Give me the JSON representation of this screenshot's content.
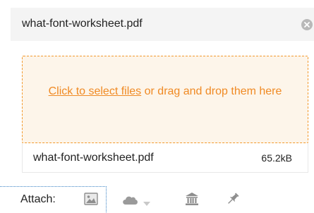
{
  "file_header": {
    "name": "what-font-worksheet.pdf",
    "remove_icon": "remove-circle-icon"
  },
  "dropzone": {
    "link_text": "Click to select files",
    "rest_text": " or drag and drop them here"
  },
  "file_row": {
    "name": "what-font-worksheet.pdf",
    "size": "65.2kB"
  },
  "attach_bar": {
    "label": "Attach:",
    "icons": [
      "image-icon",
      "cloud-icon",
      "dropdown-caret-icon",
      "bank-icon",
      "pin-icon"
    ]
  },
  "colors": {
    "accent": "#f08a24",
    "dropzone_bg": "#fdf5ea",
    "header_bg": "#f4f4f4",
    "focus": "#3a82c4"
  }
}
